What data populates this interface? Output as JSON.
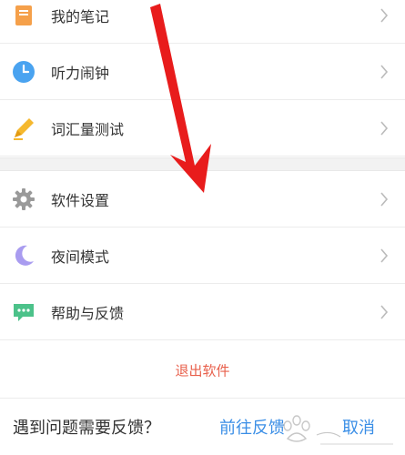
{
  "menu": {
    "items": [
      {
        "label": "我的笔记",
        "icon": "notebook-icon",
        "icon_color": "#f5a04a"
      },
      {
        "label": "听力闹钟",
        "icon": "clock-icon",
        "icon_color": "#4aa3f0"
      },
      {
        "label": "词汇量测试",
        "icon": "pen-icon",
        "icon_color": "#f5b82e"
      },
      {
        "label": "软件设置",
        "icon": "gear-icon",
        "icon_color": "#9a9a9a"
      },
      {
        "label": "夜间模式",
        "icon": "moon-icon",
        "icon_color": "#a99cf0"
      },
      {
        "label": "帮助与反馈",
        "icon": "chat-bubble-icon",
        "icon_color": "#4cc28a"
      }
    ]
  },
  "logout": {
    "label": "退出软件",
    "color": "#e8604c"
  },
  "feedback": {
    "question": "遇到问题需要反馈？",
    "go_label": "前往反馈",
    "cancel_label": "取消",
    "link_color": "#3a8ee6"
  },
  "annotation": {
    "arrow_color": "#e81c1c"
  }
}
